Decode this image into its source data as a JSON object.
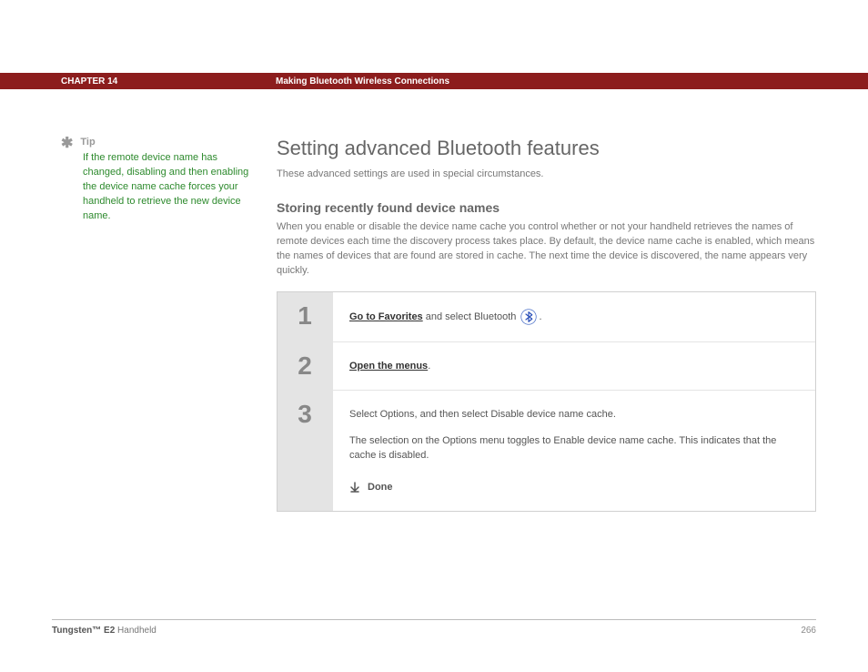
{
  "header": {
    "chapter_label": "CHAPTER 14",
    "chapter_title": "Making Bluetooth Wireless Connections"
  },
  "sidebar": {
    "tip_label": "Tip",
    "tip_text": "If the remote device name has changed, disabling and then enabling the device name cache forces your handheld to retrieve the new device name."
  },
  "main": {
    "heading": "Setting advanced Bluetooth features",
    "intro": "These advanced settings are used in special circumstances.",
    "subhead": "Storing recently found device names",
    "body": "When you enable or disable the device name cache you control whether or not your handheld retrieves the names of remote devices each time the discovery process takes place. By default, the device name cache is enabled, which means the names of devices that are found are stored in cache. The next time the device is discovered, the name appears very quickly."
  },
  "steps": [
    {
      "num": "1",
      "link": "Go to Favorites",
      "text_after_link": " and select Bluetooth ",
      "text_after_icon": ".",
      "icon": "bluetooth-icon"
    },
    {
      "num": "2",
      "link": "Open the menus",
      "text_after_link": "."
    },
    {
      "num": "3",
      "para1": "Select Options, and then select Disable device name cache.",
      "para2": "The selection on the Options menu toggles to Enable device name cache. This indicates that the cache is disabled.",
      "done_label": "Done"
    }
  ],
  "footer": {
    "product_bold": "Tungsten™ E2",
    "product_rest": " Handheld",
    "page_number": "266"
  }
}
